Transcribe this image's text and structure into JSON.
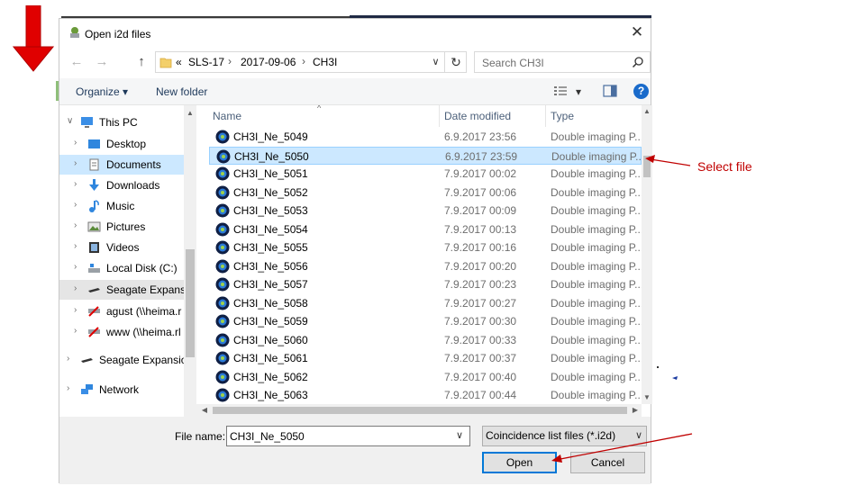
{
  "dialog": {
    "title": "Open i2d files",
    "close_glyph": "✕"
  },
  "nav": {
    "back_glyph": "←",
    "forward_glyph": "→",
    "up_glyph": "↑",
    "refresh_glyph": "↻",
    "dropdown_glyph": "∨",
    "crumbs": [
      "«",
      "SLS-17",
      "›",
      "2017-09-06",
      "›",
      "CH3I"
    ],
    "search_placeholder": "Search CH3I"
  },
  "commands": {
    "organize_label": "Organize ▾",
    "new_folder_label": "New folder",
    "view_dropdown_glyph": "▾",
    "help_glyph": "?"
  },
  "sidebar": {
    "items": [
      {
        "label": "This PC",
        "icon": "pc-icon",
        "chevron": "∨"
      },
      {
        "label": "Desktop",
        "icon": "desktop-icon",
        "chevron": "›"
      },
      {
        "label": "Documents",
        "icon": "documents-icon",
        "chevron": "›"
      },
      {
        "label": "Downloads",
        "icon": "downloads-icon",
        "chevron": "›"
      },
      {
        "label": "Music",
        "icon": "music-icon",
        "chevron": "›"
      },
      {
        "label": "Pictures",
        "icon": "pictures-icon",
        "chevron": "›"
      },
      {
        "label": "Videos",
        "icon": "videos-icon",
        "chevron": "›"
      },
      {
        "label": "Local Disk (C:)",
        "icon": "local-disk-icon",
        "chevron": "›"
      },
      {
        "label": "Seagate Expansio",
        "icon": "external-drive-icon",
        "chevron": "›"
      },
      {
        "label": "agust (\\\\heima.r",
        "icon": "network-drive-icon",
        "chevron": "›"
      },
      {
        "label": "www (\\\\heima.rl",
        "icon": "network-drive-icon",
        "chevron": "›"
      },
      {
        "label": "Seagate Expansion",
        "icon": "external-drive-icon",
        "chevron": "›"
      },
      {
        "label": "Network",
        "icon": "network-icon",
        "chevron": "›"
      }
    ]
  },
  "table": {
    "columns": [
      "Name",
      "Date modified",
      "Type"
    ],
    "sort_glyph": "^",
    "rows": [
      {
        "name": "CH3I_Ne_5049",
        "date": "6.9.2017 23:56",
        "type": "Double imaging P..."
      },
      {
        "name": "CH3I_Ne_5050",
        "date": "6.9.2017 23:59",
        "type": "Double imaging P..."
      },
      {
        "name": "CH3I_Ne_5051",
        "date": "7.9.2017 00:02",
        "type": "Double imaging P..."
      },
      {
        "name": "CH3I_Ne_5052",
        "date": "7.9.2017 00:06",
        "type": "Double imaging P..."
      },
      {
        "name": "CH3I_Ne_5053",
        "date": "7.9.2017 00:09",
        "type": "Double imaging P..."
      },
      {
        "name": "CH3I_Ne_5054",
        "date": "7.9.2017 00:13",
        "type": "Double imaging P..."
      },
      {
        "name": "CH3I_Ne_5055",
        "date": "7.9.2017 00:16",
        "type": "Double imaging P..."
      },
      {
        "name": "CH3I_Ne_5056",
        "date": "7.9.2017 00:20",
        "type": "Double imaging P..."
      },
      {
        "name": "CH3I_Ne_5057",
        "date": "7.9.2017 00:23",
        "type": "Double imaging P..."
      },
      {
        "name": "CH3I_Ne_5058",
        "date": "7.9.2017 00:27",
        "type": "Double imaging P..."
      },
      {
        "name": "CH3I_Ne_5059",
        "date": "7.9.2017 00:30",
        "type": "Double imaging P..."
      },
      {
        "name": "CH3I_Ne_5060",
        "date": "7.9.2017 00:33",
        "type": "Double imaging P..."
      },
      {
        "name": "CH3I_Ne_5061",
        "date": "7.9.2017 00:37",
        "type": "Double imaging P..."
      },
      {
        "name": "CH3I_Ne_5062",
        "date": "7.9.2017 00:40",
        "type": "Double imaging P..."
      },
      {
        "name": "CH3I_Ne_5063",
        "date": "7.9.2017 00:44",
        "type": "Double imaging P..."
      }
    ],
    "selected_index": 1
  },
  "footer": {
    "file_name_label": "File name:",
    "file_name_value": "CH3I_Ne_5050",
    "file_name_dropdown_glyph": "∨",
    "filter_value": "Coincidence list files (*.i2d)",
    "filter_dropdown_glyph": "∨",
    "open_label": "Open",
    "cancel_label": "Cancel"
  },
  "annotation": {
    "text": "Select file",
    "color": "#c00000"
  },
  "colors": {
    "selection": "#cce8ff",
    "accent": "#0078d7",
    "arrow_red": "#e00000"
  }
}
